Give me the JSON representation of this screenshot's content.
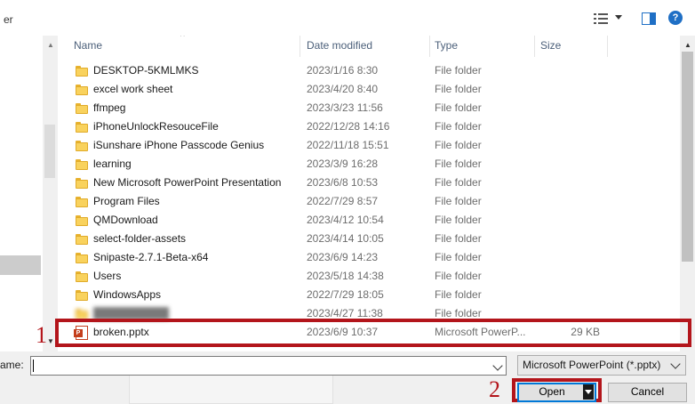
{
  "window": {
    "title_fragment": "er"
  },
  "toolbar": {
    "view_icon": "details-view-icon",
    "preview_icon": "preview-pane-icon",
    "help_icon": "help-icon",
    "help_glyph": "?"
  },
  "columns": {
    "name": "Name",
    "date": "Date modified",
    "type": "Type",
    "size": "Size",
    "sort_indicator": "^"
  },
  "files": [
    {
      "name": "DESKTOP-5KMLMKS",
      "date": "2023/1/16 8:30",
      "type": "File folder",
      "size": ""
    },
    {
      "name": "excel work sheet",
      "date": "2023/4/20 8:40",
      "type": "File folder",
      "size": ""
    },
    {
      "name": "ffmpeg",
      "date": "2023/3/23 11:56",
      "type": "File folder",
      "size": ""
    },
    {
      "name": "iPhoneUnlockResouceFile",
      "date": "2022/12/28 14:16",
      "type": "File folder",
      "size": ""
    },
    {
      "name": "iSunshare iPhone Passcode Genius",
      "date": "2022/11/18 15:51",
      "type": "File folder",
      "size": ""
    },
    {
      "name": "learning",
      "date": "2023/3/9 16:28",
      "type": "File folder",
      "size": ""
    },
    {
      "name": "New Microsoft PowerPoint Presentation",
      "date": "2023/6/8 10:53",
      "type": "File folder",
      "size": ""
    },
    {
      "name": "Program Files",
      "date": "2022/7/29 8:57",
      "type": "File folder",
      "size": ""
    },
    {
      "name": "QMDownload",
      "date": "2023/4/12 10:54",
      "type": "File folder",
      "size": ""
    },
    {
      "name": "select-folder-assets",
      "date": "2023/4/14 10:05",
      "type": "File folder",
      "size": ""
    },
    {
      "name": "Snipaste-2.7.1-Beta-x64",
      "date": "2023/6/9 14:23",
      "type": "File folder",
      "size": ""
    },
    {
      "name": "Users",
      "date": "2023/5/18 14:38",
      "type": "File folder",
      "size": ""
    },
    {
      "name": "WindowsApps",
      "date": "2022/7/29 18:05",
      "type": "File folder",
      "size": ""
    },
    {
      "name": "",
      "date": "2023/4/27 11:38",
      "type": "File folder",
      "size": ""
    },
    {
      "name": "broken.pptx",
      "date": "2023/6/9 10:37",
      "type": "Microsoft PowerP...",
      "size": "29 KB"
    }
  ],
  "annotations": {
    "step1": "1",
    "step2": "2",
    "highlight_color": "#b3151b"
  },
  "bottom": {
    "filename_label": "ame:",
    "filename_value": "",
    "filetype_selected": "Microsoft PowerPoint (*.pptx)",
    "open_label": "Open",
    "cancel_label": "Cancel"
  }
}
